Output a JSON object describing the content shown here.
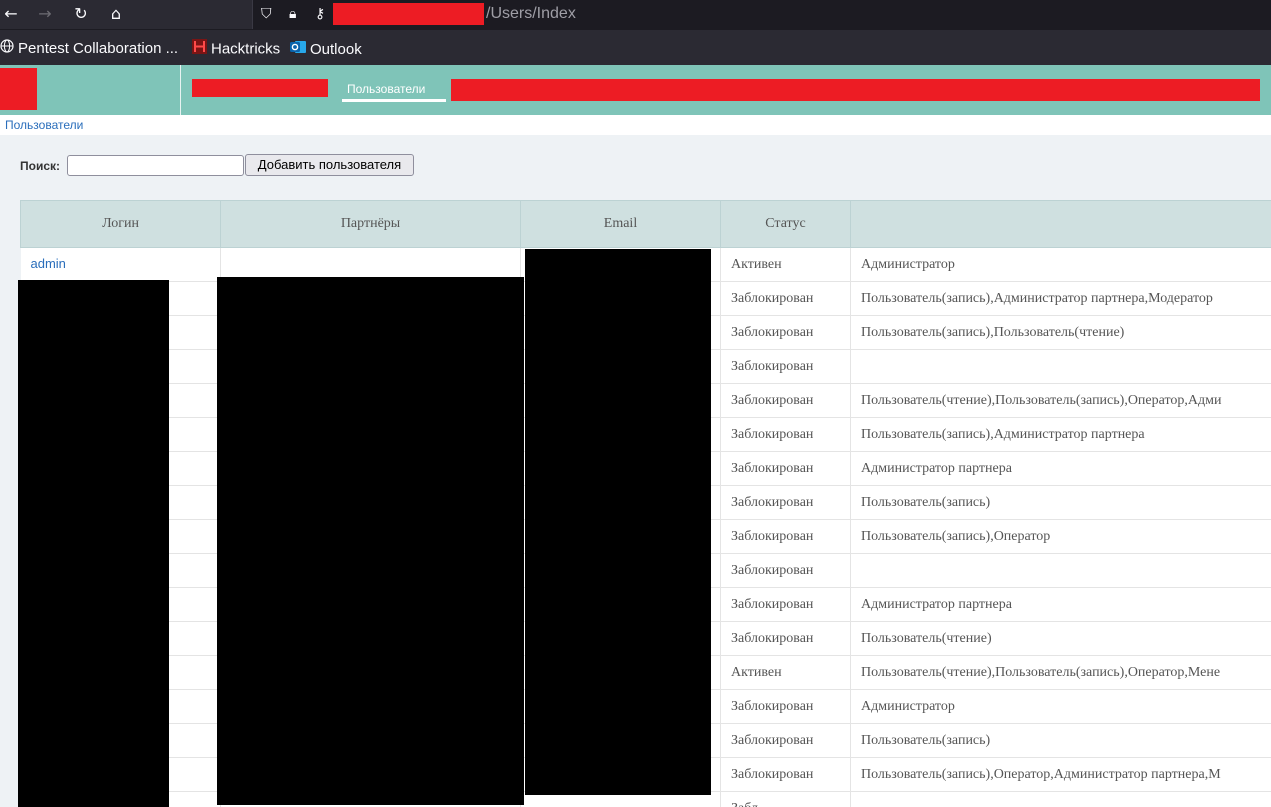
{
  "browser": {
    "url_path": "/Users/Index",
    "bookmarks": [
      {
        "label": "Pentest Collaboration ...",
        "icon": "globe-icon"
      },
      {
        "label": "Hacktricks",
        "icon": "hacktricks-icon"
      },
      {
        "label": "Outlook",
        "icon": "outlook-icon"
      }
    ]
  },
  "header": {
    "active_tab": "Пользователи"
  },
  "breadcrumb": "Пользователи",
  "toolbar": {
    "search_label": "Поиск:",
    "search_value": "",
    "add_user_label": "Добавить пользователя"
  },
  "table": {
    "columns": [
      "Логин",
      "Партнёры",
      "Email",
      "Статус",
      ""
    ],
    "rows": [
      {
        "login": "admin",
        "partners": "",
        "email": "",
        "status": "Активен",
        "roles": "Администратор"
      },
      {
        "login": "",
        "partners": "",
        "email": "",
        "status": "Заблокирован",
        "roles": "Пользователь(запись),Администратор партнера,Модератор"
      },
      {
        "login": "",
        "partners": "",
        "email": "",
        "status": "Заблокирован",
        "roles": "Пользователь(запись),Пользователь(чтение)"
      },
      {
        "login": "",
        "partners": "",
        "email": "",
        "status": "Заблокирован",
        "roles": ""
      },
      {
        "login": "",
        "partners": "",
        "email": "",
        "status": "Заблокирован",
        "roles": "Пользователь(чтение),Пользователь(запись),Оператор,Адми"
      },
      {
        "login": "",
        "partners": "",
        "email": "",
        "status": "Заблокирован",
        "roles": "Пользователь(запись),Администратор партнера"
      },
      {
        "login": "",
        "partners": "",
        "email": "",
        "status": "Заблокирован",
        "roles": "Администратор партнера"
      },
      {
        "login": "",
        "partners": "",
        "email": "",
        "status": "Заблокирован",
        "roles": "Пользователь(запись)"
      },
      {
        "login": "",
        "partners": "",
        "email": "",
        "status": "Заблокирован",
        "roles": "Пользователь(запись),Оператор"
      },
      {
        "login": "",
        "partners": "",
        "email": "",
        "status": "Заблокирован",
        "roles": ""
      },
      {
        "login": "",
        "partners": "",
        "email": "",
        "status": "Заблокирован",
        "roles": "Администратор партнера"
      },
      {
        "login": "",
        "partners": "",
        "email": "",
        "status": "Заблокирован",
        "roles": "Пользователь(чтение)"
      },
      {
        "login": "",
        "partners": "",
        "email": "",
        "status": "Активен",
        "roles": "Пользователь(чтение),Пользователь(запись),Оператор,Мене"
      },
      {
        "login": "",
        "partners": "",
        "email": "",
        "status": "Заблокирован",
        "roles": "Администратор"
      },
      {
        "login": "",
        "partners": "",
        "email": "",
        "status": "Заблокирован",
        "roles": "Пользователь(запись)"
      },
      {
        "login": "",
        "partners": "",
        "email": "",
        "status": "Заблокирован",
        "roles": "Пользователь(запись),Оператор,Администратор партнера,М"
      },
      {
        "login": "",
        "partners": "",
        "email": "",
        "status": "Забл",
        "roles": ""
      }
    ]
  }
}
